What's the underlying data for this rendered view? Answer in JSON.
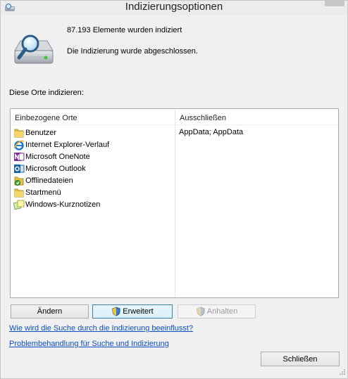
{
  "window": {
    "title": "Indizierungsoptionen"
  },
  "status": {
    "indexed_count": "87.193 Elemente wurden indiziert",
    "state": "Die Indizierung wurde abgeschlossen."
  },
  "locations": {
    "section_label": "Diese Orte indizieren:",
    "col_included": "Einbezogene Orte",
    "col_excluded": "Ausschließen",
    "items": [
      {
        "label": "Benutzer",
        "icon": "folder-icon"
      },
      {
        "label": "Internet Explorer-Verlauf",
        "icon": "internet-explorer-icon"
      },
      {
        "label": "Microsoft OneNote",
        "icon": "onenote-icon"
      },
      {
        "label": "Microsoft Outlook",
        "icon": "outlook-icon"
      },
      {
        "label": "Offlinedateien",
        "icon": "offline-files-icon"
      },
      {
        "label": "Startmenü",
        "icon": "folder-icon"
      },
      {
        "label": "Windows-Kurznotizen",
        "icon": "sticky-notes-icon"
      }
    ],
    "excluded_value": "AppData; AppData"
  },
  "buttons": {
    "modify": "Ändern",
    "advanced": "Erweitert",
    "pause": "Anhalten",
    "close": "Schließen"
  },
  "links": {
    "how_indexing": "Wie wird die Suche durch die Indizierung beeinflusst?",
    "troubleshoot": "Problembehandlung für Suche und Indizierung"
  }
}
